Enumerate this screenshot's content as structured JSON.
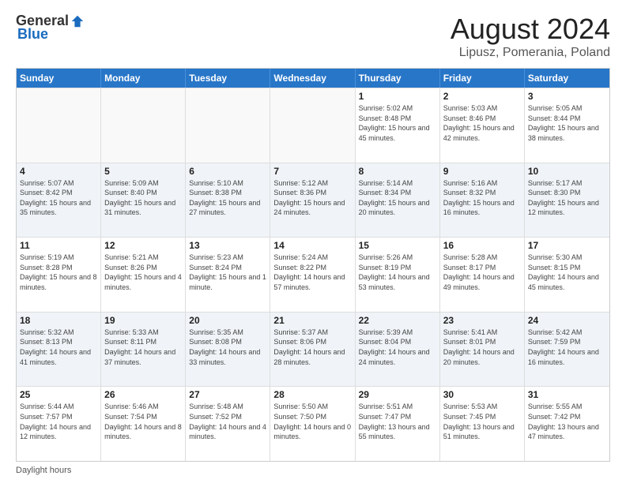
{
  "header": {
    "logo_general": "General",
    "logo_blue": "Blue",
    "title": "August 2024",
    "subtitle": "Lipusz, Pomerania, Poland"
  },
  "calendar": {
    "days_of_week": [
      "Sunday",
      "Monday",
      "Tuesday",
      "Wednesday",
      "Thursday",
      "Friday",
      "Saturday"
    ],
    "weeks": [
      [
        {
          "day": "",
          "info": "",
          "empty": true
        },
        {
          "day": "",
          "info": "",
          "empty": true
        },
        {
          "day": "",
          "info": "",
          "empty": true
        },
        {
          "day": "",
          "info": "",
          "empty": true
        },
        {
          "day": "1",
          "info": "Sunrise: 5:02 AM\nSunset: 8:48 PM\nDaylight: 15 hours\nand 45 minutes.",
          "empty": false
        },
        {
          "day": "2",
          "info": "Sunrise: 5:03 AM\nSunset: 8:46 PM\nDaylight: 15 hours\nand 42 minutes.",
          "empty": false
        },
        {
          "day": "3",
          "info": "Sunrise: 5:05 AM\nSunset: 8:44 PM\nDaylight: 15 hours\nand 38 minutes.",
          "empty": false
        }
      ],
      [
        {
          "day": "4",
          "info": "Sunrise: 5:07 AM\nSunset: 8:42 PM\nDaylight: 15 hours\nand 35 minutes.",
          "empty": false
        },
        {
          "day": "5",
          "info": "Sunrise: 5:09 AM\nSunset: 8:40 PM\nDaylight: 15 hours\nand 31 minutes.",
          "empty": false
        },
        {
          "day": "6",
          "info": "Sunrise: 5:10 AM\nSunset: 8:38 PM\nDaylight: 15 hours\nand 27 minutes.",
          "empty": false
        },
        {
          "day": "7",
          "info": "Sunrise: 5:12 AM\nSunset: 8:36 PM\nDaylight: 15 hours\nand 24 minutes.",
          "empty": false
        },
        {
          "day": "8",
          "info": "Sunrise: 5:14 AM\nSunset: 8:34 PM\nDaylight: 15 hours\nand 20 minutes.",
          "empty": false
        },
        {
          "day": "9",
          "info": "Sunrise: 5:16 AM\nSunset: 8:32 PM\nDaylight: 15 hours\nand 16 minutes.",
          "empty": false
        },
        {
          "day": "10",
          "info": "Sunrise: 5:17 AM\nSunset: 8:30 PM\nDaylight: 15 hours\nand 12 minutes.",
          "empty": false
        }
      ],
      [
        {
          "day": "11",
          "info": "Sunrise: 5:19 AM\nSunset: 8:28 PM\nDaylight: 15 hours\nand 8 minutes.",
          "empty": false
        },
        {
          "day": "12",
          "info": "Sunrise: 5:21 AM\nSunset: 8:26 PM\nDaylight: 15 hours\nand 4 minutes.",
          "empty": false
        },
        {
          "day": "13",
          "info": "Sunrise: 5:23 AM\nSunset: 8:24 PM\nDaylight: 15 hours\nand 1 minute.",
          "empty": false
        },
        {
          "day": "14",
          "info": "Sunrise: 5:24 AM\nSunset: 8:22 PM\nDaylight: 14 hours\nand 57 minutes.",
          "empty": false
        },
        {
          "day": "15",
          "info": "Sunrise: 5:26 AM\nSunset: 8:19 PM\nDaylight: 14 hours\nand 53 minutes.",
          "empty": false
        },
        {
          "day": "16",
          "info": "Sunrise: 5:28 AM\nSunset: 8:17 PM\nDaylight: 14 hours\nand 49 minutes.",
          "empty": false
        },
        {
          "day": "17",
          "info": "Sunrise: 5:30 AM\nSunset: 8:15 PM\nDaylight: 14 hours\nand 45 minutes.",
          "empty": false
        }
      ],
      [
        {
          "day": "18",
          "info": "Sunrise: 5:32 AM\nSunset: 8:13 PM\nDaylight: 14 hours\nand 41 minutes.",
          "empty": false
        },
        {
          "day": "19",
          "info": "Sunrise: 5:33 AM\nSunset: 8:11 PM\nDaylight: 14 hours\nand 37 minutes.",
          "empty": false
        },
        {
          "day": "20",
          "info": "Sunrise: 5:35 AM\nSunset: 8:08 PM\nDaylight: 14 hours\nand 33 minutes.",
          "empty": false
        },
        {
          "day": "21",
          "info": "Sunrise: 5:37 AM\nSunset: 8:06 PM\nDaylight: 14 hours\nand 28 minutes.",
          "empty": false
        },
        {
          "day": "22",
          "info": "Sunrise: 5:39 AM\nSunset: 8:04 PM\nDaylight: 14 hours\nand 24 minutes.",
          "empty": false
        },
        {
          "day": "23",
          "info": "Sunrise: 5:41 AM\nSunset: 8:01 PM\nDaylight: 14 hours\nand 20 minutes.",
          "empty": false
        },
        {
          "day": "24",
          "info": "Sunrise: 5:42 AM\nSunset: 7:59 PM\nDaylight: 14 hours\nand 16 minutes.",
          "empty": false
        }
      ],
      [
        {
          "day": "25",
          "info": "Sunrise: 5:44 AM\nSunset: 7:57 PM\nDaylight: 14 hours\nand 12 minutes.",
          "empty": false
        },
        {
          "day": "26",
          "info": "Sunrise: 5:46 AM\nSunset: 7:54 PM\nDaylight: 14 hours\nand 8 minutes.",
          "empty": false
        },
        {
          "day": "27",
          "info": "Sunrise: 5:48 AM\nSunset: 7:52 PM\nDaylight: 14 hours\nand 4 minutes.",
          "empty": false
        },
        {
          "day": "28",
          "info": "Sunrise: 5:50 AM\nSunset: 7:50 PM\nDaylight: 14 hours\nand 0 minutes.",
          "empty": false
        },
        {
          "day": "29",
          "info": "Sunrise: 5:51 AM\nSunset: 7:47 PM\nDaylight: 13 hours\nand 55 minutes.",
          "empty": false
        },
        {
          "day": "30",
          "info": "Sunrise: 5:53 AM\nSunset: 7:45 PM\nDaylight: 13 hours\nand 51 minutes.",
          "empty": false
        },
        {
          "day": "31",
          "info": "Sunrise: 5:55 AM\nSunset: 7:42 PM\nDaylight: 13 hours\nand 47 minutes.",
          "empty": false
        }
      ]
    ],
    "footer": "Daylight hours"
  }
}
